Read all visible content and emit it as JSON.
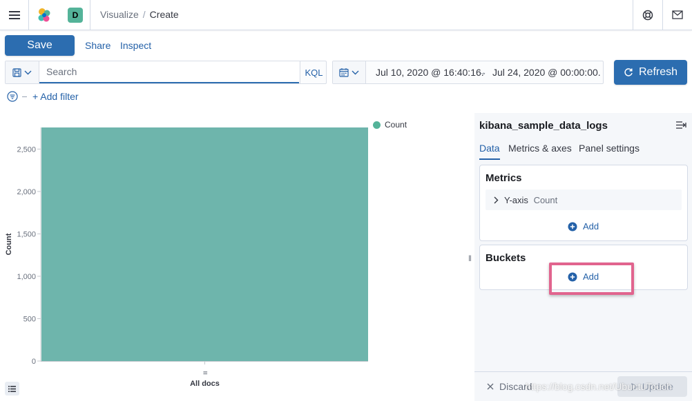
{
  "header": {
    "breadcrumbs": [
      "Visualize",
      "Create"
    ],
    "space_initial": "D",
    "space_color": "#54b399"
  },
  "nav": {
    "save_label": "Save",
    "share_label": "Share",
    "inspect_label": "Inspect"
  },
  "query": {
    "placeholder": "Search",
    "language": "KQL"
  },
  "date_range": {
    "start": "Jul 10, 2020 @ 16:40:16.",
    "arrow": "→",
    "end": "Jul 24, 2020 @ 00:00:00.",
    "refresh_label": "Refresh"
  },
  "filters": {
    "add_label": "+ Add filter"
  },
  "chart_data": {
    "type": "bar",
    "categories": [
      "All docs"
    ],
    "series": [
      {
        "name": "Count",
        "values": [
          2755
        ],
        "color": "#6eb5ac"
      }
    ],
    "ylabel": "Count",
    "xlabel": "",
    "ylim": [
      0,
      2755
    ],
    "yticks": [
      0,
      500,
      1000,
      1500,
      2000,
      2500
    ],
    "ytick_labels": [
      "0",
      "500",
      "1,000",
      "1,500",
      "2,000",
      "2,500"
    ],
    "legend": "top-right",
    "grid": false
  },
  "sidebar": {
    "index_pattern": "kibana_sample_data_logs",
    "tabs": [
      {
        "label": "Data",
        "active": true
      },
      {
        "label": "Metrics & axes",
        "active": false
      },
      {
        "label": "Panel settings",
        "active": false
      }
    ],
    "metrics": {
      "title": "Metrics",
      "items": [
        {
          "label": "Y-axis",
          "value": "Count"
        }
      ],
      "add_label": "Add"
    },
    "buckets": {
      "title": "Buckets",
      "add_label": "Add"
    },
    "footer": {
      "discard_label": "Discard",
      "update_label": "Update"
    }
  },
  "watermark": "https://blog.csdn.net/UbuntuTouch",
  "colors": {
    "accent": "#2c6db0",
    "link": "#2461a8",
    "bar": "#6eb5ac",
    "highlight": "#e1648e"
  }
}
